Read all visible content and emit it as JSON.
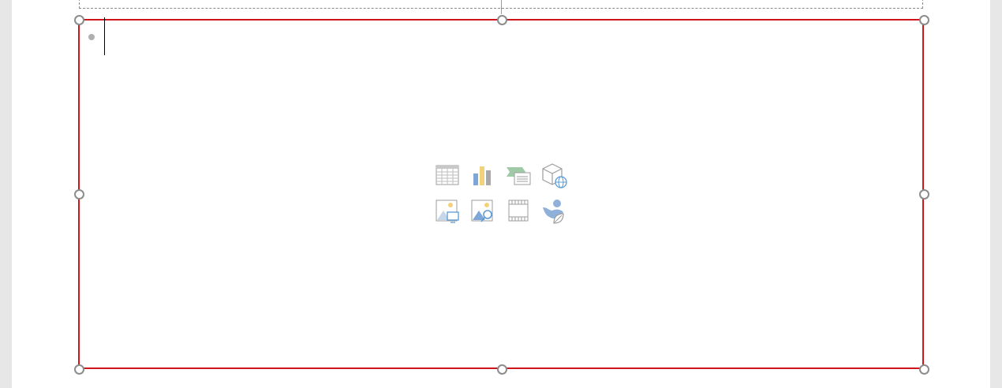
{
  "slide": {
    "content_placeholder": {
      "bullet_text": "",
      "insert_icons": [
        "insert-table-icon",
        "insert-chart-icon",
        "insert-smartart-icon",
        "insert-3d-model-icon",
        "insert-stock-image-icon",
        "insert-picture-icon",
        "insert-video-icon",
        "insert-icon-icon"
      ]
    }
  },
  "colors": {
    "selection_border": "#d0161b",
    "handle": "#8c8c8c",
    "icon_gray": "#9d9d9d",
    "icon_blue": "#7ea7d8",
    "icon_yellow": "#f3d27a",
    "icon_green": "#9fc9a7"
  }
}
